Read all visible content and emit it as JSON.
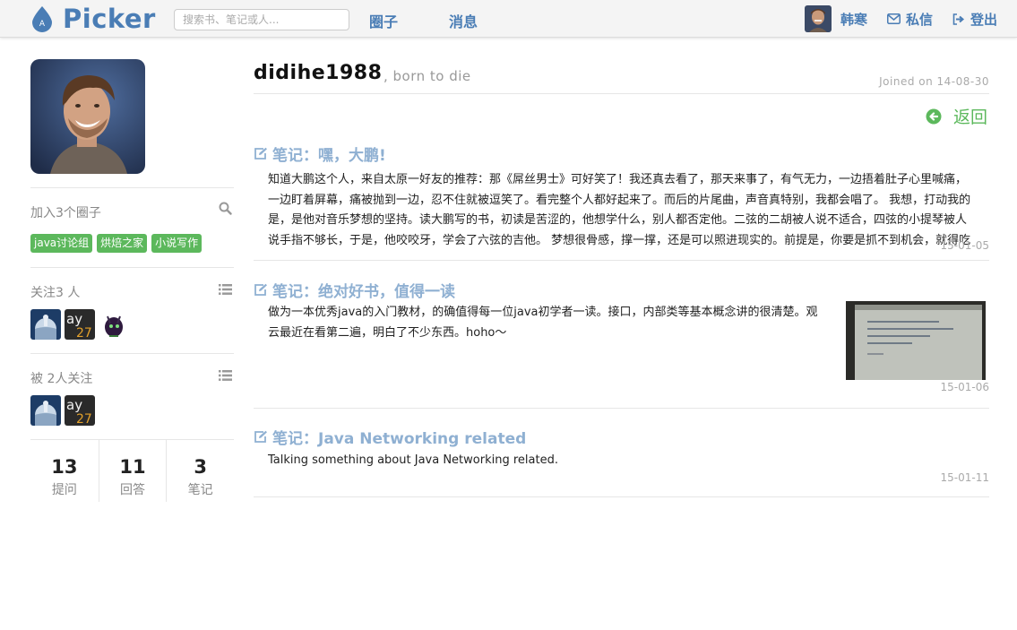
{
  "brand": {
    "name": "Picker",
    "badge": "A"
  },
  "search": {
    "placeholder": "搜索书、笔记或人..."
  },
  "nav": {
    "circles": "圈子",
    "messages": "消息"
  },
  "account": {
    "name": "韩寒",
    "messages_label": "私信",
    "logout_label": "登出"
  },
  "profile": {
    "username": "didihe1988",
    "tagline": ", born to die",
    "joined": "Joined on 14-08-30",
    "back_label": "返回"
  },
  "sidebar": {
    "groups": {
      "title": "加入3个圈子",
      "tags": [
        "java讨论组",
        "烘焙之家",
        "小说写作"
      ]
    },
    "following": {
      "title": "关注3 人"
    },
    "followers": {
      "title": "被 2人关注"
    },
    "avatar_text": {
      "ay": "ay",
      "num": "27"
    },
    "stats": [
      {
        "value": "13",
        "label": "提问"
      },
      {
        "value": "11",
        "label": "回答"
      },
      {
        "value": "3",
        "label": "笔记"
      }
    ]
  },
  "notes": [
    {
      "title": "笔记：嘿，大鹏!",
      "body": "知道大鹏这个人，来自太原一好友的推荐：那《屌丝男士》可好笑了！我还真去看了，那天来事了，有气无力，一边捂着肚子心里喊痛，一边盯着屏幕，痛被抛到一边，忍不住就被逗笑了。看完整个人都好起来了。而后的片尾曲，声音真特别，我都会唱了。 我想，打动我的是，是他对音乐梦想的坚持。读大鹏写的书，初读是苦涩的，他想学什么，别人都否定他。二弦的二胡被人说不适合，四弦的小提琴被人说手指不够长，于是，他咬咬牙，学会了六弦的吉他。 梦想很骨感，撑一撑，还是可以照进现实的。前提是，你要是抓不到机会，就得吃点苦头。",
      "date": "15-01-05"
    },
    {
      "title": "笔记：绝对好书，值得一读",
      "body": "做为一本优秀java的入门教材，的确值得每一位java初学者一读。接口，内部类等基本概念讲的很清楚。观云最近在看第二遍，明白了不少东西。hoho～",
      "date": "15-01-06"
    },
    {
      "title": "笔记：Java Networking related",
      "body": "Talking something about Java Networking related.",
      "date": "15-01-11"
    }
  ],
  "colors": {
    "brand": "#4a7db5",
    "tag_green": "#5cb85c",
    "note_title": "#8fb0d2"
  }
}
